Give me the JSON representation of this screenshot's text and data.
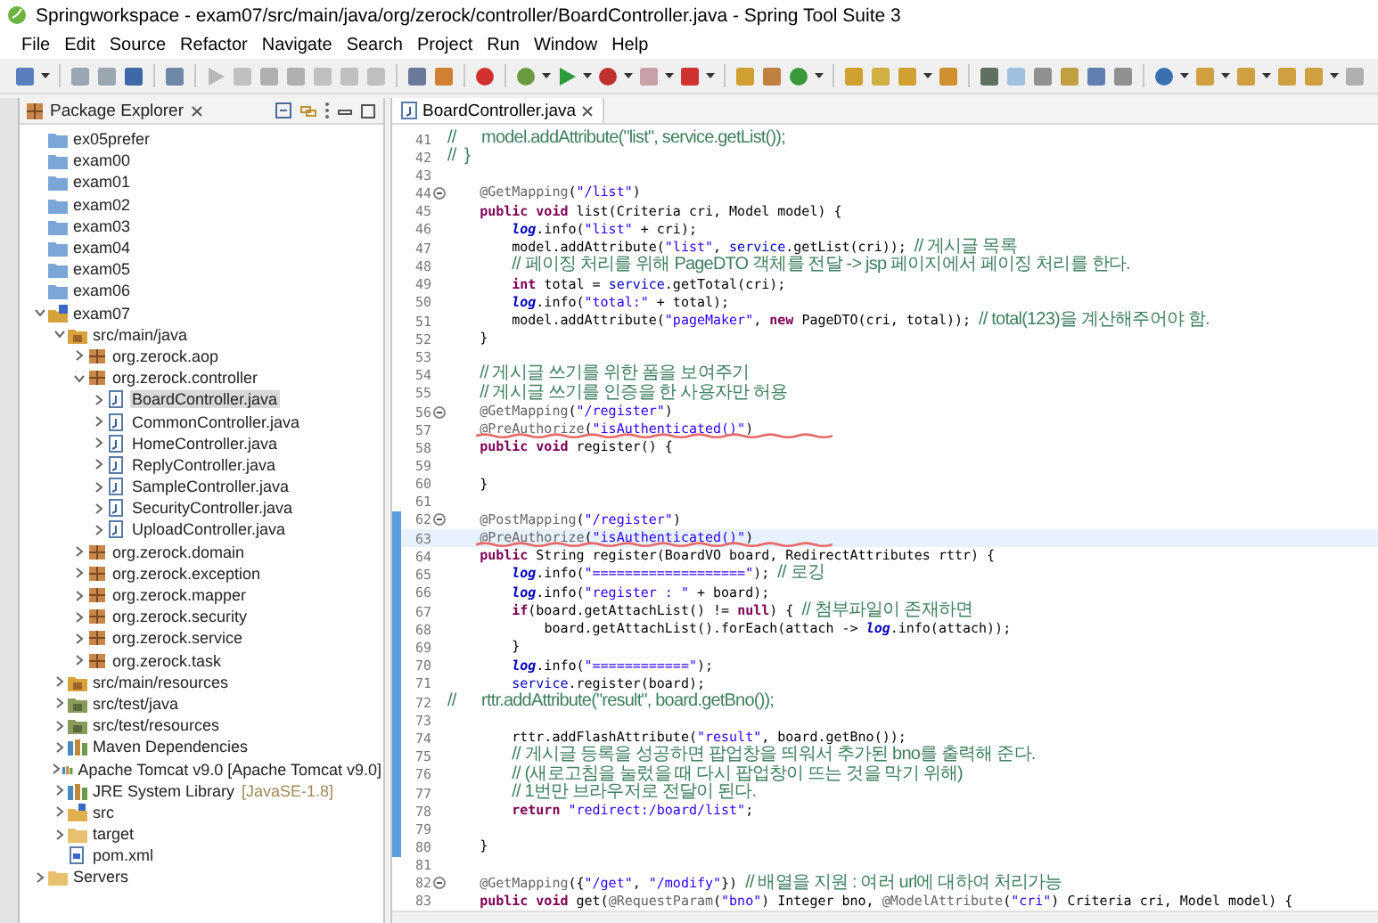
{
  "window": {
    "title": "Springworkspace - exam07/src/main/java/org/zerock/controller/BoardController.java - Spring Tool Suite 3"
  },
  "menu": [
    "File",
    "Edit",
    "Source",
    "Refactor",
    "Navigate",
    "Search",
    "Project",
    "Run",
    "Window",
    "Help"
  ],
  "package_explorer": {
    "title": "Package Explorer",
    "tree": [
      {
        "label": "ex05prefer",
        "kind": "closed_project",
        "selected": false
      },
      {
        "label": "exam00",
        "kind": "closed_project",
        "selected": false
      },
      {
        "label": "exam01",
        "kind": "closed_project",
        "selected": false
      },
      {
        "label": "exam02",
        "kind": "closed_project",
        "selected": false
      },
      {
        "label": "exam03",
        "kind": "closed_project",
        "selected": false
      },
      {
        "label": "exam04",
        "kind": "closed_project",
        "selected": false
      },
      {
        "label": "exam05",
        "kind": "closed_project",
        "selected": false
      },
      {
        "label": "exam06",
        "kind": "closed_project",
        "selected": false
      },
      {
        "label": "exam07",
        "kind": "project",
        "expanded": true,
        "selected": false,
        "children": [
          {
            "label": "src/main/java",
            "kind": "source_folder",
            "expanded": true,
            "selected": false,
            "children": [
              {
                "label": "org.zerock.aop",
                "kind": "package",
                "expanded": false,
                "selected": false
              },
              {
                "label": "org.zerock.controller",
                "kind": "package",
                "expanded": true,
                "selected": false,
                "children": [
                  {
                    "label": "BoardController.java",
                    "kind": "java_file",
                    "expanded": false,
                    "selected": true
                  },
                  {
                    "label": "CommonController.java",
                    "kind": "java_file",
                    "expanded": false,
                    "selected": false
                  },
                  {
                    "label": "HomeController.java",
                    "kind": "java_file",
                    "expanded": false,
                    "selected": false
                  },
                  {
                    "label": "ReplyController.java",
                    "kind": "java_file",
                    "expanded": false,
                    "selected": false
                  },
                  {
                    "label": "SampleController.java",
                    "kind": "java_file",
                    "expanded": false,
                    "selected": false
                  },
                  {
                    "label": "SecurityController.java",
                    "kind": "java_file",
                    "expanded": false,
                    "selected": false
                  },
                  {
                    "label": "UploadController.java",
                    "kind": "java_file",
                    "expanded": false,
                    "selected": false
                  }
                ]
              },
              {
                "label": "org.zerock.domain",
                "kind": "package",
                "expanded": false,
                "selected": false
              },
              {
                "label": "org.zerock.exception",
                "kind": "package",
                "expanded": false,
                "selected": false
              },
              {
                "label": "org.zerock.mapper",
                "kind": "package",
                "expanded": false,
                "selected": false
              },
              {
                "label": "org.zerock.security",
                "kind": "package",
                "expanded": false,
                "selected": false
              },
              {
                "label": "org.zerock.service",
                "kind": "package",
                "expanded": false,
                "selected": false
              },
              {
                "label": "org.zerock.task",
                "kind": "package",
                "expanded": false,
                "selected": false
              }
            ]
          },
          {
            "label": "src/main/resources",
            "kind": "source_folder",
            "expanded": false,
            "selected": false
          },
          {
            "label": "src/test/java",
            "kind": "test_folder",
            "expanded": false,
            "selected": false
          },
          {
            "label": "src/test/resources",
            "kind": "test_folder",
            "expanded": false,
            "selected": false
          },
          {
            "label": "Maven Dependencies",
            "kind": "library",
            "expanded": false,
            "selected": false
          },
          {
            "label": "Apache Tomcat v9.0 [Apache Tomcat v9.0]",
            "kind": "library",
            "expanded": false,
            "selected": false
          },
          {
            "label": "JRE System Library",
            "decoration": "[JavaSE-1.8]",
            "kind": "library",
            "expanded": false,
            "selected": false
          },
          {
            "label": "src",
            "kind": "spring_folder",
            "expanded": false,
            "selected": false
          },
          {
            "label": "target",
            "kind": "folder",
            "expanded": false,
            "selected": false
          },
          {
            "label": "pom.xml",
            "kind": "xml_file",
            "selected": false
          }
        ]
      },
      {
        "label": "Servers",
        "kind": "folder",
        "expanded": false,
        "selected": false
      }
    ]
  },
  "editor": {
    "tabs": [
      {
        "label": "BoardController.java",
        "selected": true
      }
    ],
    "lines": [
      {
        "number": "41",
        "fold": false,
        "changed": false,
        "current": false,
        "pen_mark": false,
        "tokens": [
          {
            "kind": "comment",
            "text": "//      model.addAttribute(\"list\", service.getList());"
          }
        ]
      },
      {
        "number": "42",
        "fold": false,
        "changed": false,
        "current": false,
        "pen_mark": false,
        "tokens": [
          {
            "kind": "comment",
            "text": "//  }"
          }
        ]
      },
      {
        "number": "43",
        "fold": false,
        "changed": false,
        "current": false,
        "pen_mark": false
      },
      {
        "number": "44",
        "fold": true,
        "changed": false,
        "current": false,
        "pen_mark": false,
        "tokens": [
          {
            "kind": "annotation",
            "text": "    @GetMapping"
          },
          {
            "kind": "plain",
            "text": "("
          },
          {
            "kind": "string",
            "text": "\"/list\""
          },
          {
            "kind": "plain",
            "text": ")"
          }
        ]
      },
      {
        "number": "45",
        "fold": false,
        "changed": false,
        "current": false,
        "pen_mark": false,
        "tokens": [
          {
            "kind": "keyword",
            "text": "    public void"
          },
          {
            "kind": "plain",
            "text": " list(Criteria cri, Model model) {"
          }
        ]
      },
      {
        "number": "46",
        "fold": false,
        "changed": false,
        "current": false,
        "pen_mark": false,
        "tokens": [
          {
            "kind": "static",
            "text": "        log"
          },
          {
            "kind": "plain",
            "text": ".info("
          },
          {
            "kind": "string",
            "text": "\"list\""
          },
          {
            "kind": "plain",
            "text": " + cri);"
          }
        ]
      },
      {
        "number": "47",
        "fold": false,
        "changed": false,
        "current": false,
        "pen_mark": false,
        "tokens": [
          {
            "kind": "plain",
            "text": "        model.addAttribute("
          },
          {
            "kind": "string",
            "text": "\"list\""
          },
          {
            "kind": "plain",
            "text": ", "
          },
          {
            "kind": "field",
            "text": "service"
          },
          {
            "kind": "plain",
            "text": ".getList(cri)); "
          },
          {
            "kind": "comment",
            "text": "// 게시글 목록"
          }
        ]
      },
      {
        "number": "48",
        "fold": false,
        "changed": false,
        "current": false,
        "pen_mark": false,
        "tokens": [
          {
            "kind": "comment",
            "text": "        // 페이징 처리를 위해 PageDTO 객체를 전달 -> jsp 페이지에서 페이징 처리를 한다."
          }
        ]
      },
      {
        "number": "49",
        "fold": false,
        "changed": false,
        "current": false,
        "pen_mark": false,
        "tokens": [
          {
            "kind": "keyword",
            "text": "        int"
          },
          {
            "kind": "plain",
            "text": " total = "
          },
          {
            "kind": "field",
            "text": "service"
          },
          {
            "kind": "plain",
            "text": ".getTotal(cri);"
          }
        ]
      },
      {
        "number": "50",
        "fold": false,
        "changed": false,
        "current": false,
        "pen_mark": false,
        "tokens": [
          {
            "kind": "static",
            "text": "        log"
          },
          {
            "kind": "plain",
            "text": ".info("
          },
          {
            "kind": "string",
            "text": "\"total:\""
          },
          {
            "kind": "plain",
            "text": " + total);"
          }
        ]
      },
      {
        "number": "51",
        "fold": false,
        "changed": false,
        "current": false,
        "pen_mark": false,
        "tokens": [
          {
            "kind": "plain",
            "text": "        model.addAttribute("
          },
          {
            "kind": "string",
            "text": "\"pageMaker\""
          },
          {
            "kind": "plain",
            "text": ", "
          },
          {
            "kind": "keyword",
            "text": "new"
          },
          {
            "kind": "plain",
            "text": " PageDTO(cri, total)); "
          },
          {
            "kind": "comment",
            "text": "// total(123)을 계산해주어야 함."
          }
        ]
      },
      {
        "number": "52",
        "fold": false,
        "changed": false,
        "current": false,
        "pen_mark": false,
        "tokens": [
          {
            "kind": "plain",
            "text": "    }"
          }
        ]
      },
      {
        "number": "53",
        "fold": false,
        "changed": false,
        "current": false,
        "pen_mark": false
      },
      {
        "number": "54",
        "fold": false,
        "changed": false,
        "current": false,
        "pen_mark": false,
        "tokens": [
          {
            "kind": "comment",
            "text": "    // 게시글 쓰기를 위한 폼을 보여주기"
          }
        ]
      },
      {
        "number": "55",
        "fold": false,
        "changed": false,
        "current": false,
        "pen_mark": false,
        "tokens": [
          {
            "kind": "comment",
            "text": "    // 게시글 쓰기를 인증을 한 사용자만 허용"
          }
        ]
      },
      {
        "number": "56",
        "fold": true,
        "changed": false,
        "current": false,
        "pen_mark": false,
        "tokens": [
          {
            "kind": "annotation",
            "text": "    @GetMapping"
          },
          {
            "kind": "plain",
            "text": "("
          },
          {
            "kind": "string",
            "text": "\"/register\""
          },
          {
            "kind": "plain",
            "text": ")"
          }
        ]
      },
      {
        "number": "57",
        "fold": false,
        "changed": false,
        "current": false,
        "pen_mark": true,
        "tokens": [
          {
            "kind": "annotation",
            "text": "    @PreAuthorize"
          },
          {
            "kind": "plain",
            "text": "("
          },
          {
            "kind": "string",
            "text": "\"isAuthenticated()\""
          },
          {
            "kind": "plain",
            "text": ")"
          }
        ]
      },
      {
        "number": "58",
        "fold": false,
        "changed": false,
        "current": false,
        "pen_mark": false,
        "tokens": [
          {
            "kind": "keyword",
            "text": "    public void"
          },
          {
            "kind": "plain",
            "text": " register() {"
          }
        ]
      },
      {
        "number": "59",
        "fold": false,
        "changed": false,
        "current": false,
        "pen_mark": false
      },
      {
        "number": "60",
        "fold": false,
        "changed": false,
        "current": false,
        "pen_mark": false,
        "tokens": [
          {
            "kind": "plain",
            "text": "    }"
          }
        ]
      },
      {
        "number": "61",
        "fold": false,
        "changed": false,
        "current": false,
        "pen_mark": false
      },
      {
        "number": "62",
        "fold": true,
        "changed": true,
        "current": false,
        "pen_mark": false,
        "tokens": [
          {
            "kind": "annotation",
            "text": "    @PostMapping"
          },
          {
            "kind": "plain",
            "text": "("
          },
          {
            "kind": "string",
            "text": "\"/register\""
          },
          {
            "kind": "plain",
            "text": ")"
          }
        ]
      },
      {
        "number": "63",
        "fold": false,
        "changed": true,
        "current": true,
        "pen_mark": true,
        "tokens": [
          {
            "kind": "annotation",
            "text": "    @PreAuthorize"
          },
          {
            "kind": "plain",
            "text": "("
          },
          {
            "kind": "string",
            "text": "\"isAuthenticated()\""
          },
          {
            "kind": "plain",
            "text": ")"
          }
        ]
      },
      {
        "number": "64",
        "fold": false,
        "changed": true,
        "current": false,
        "pen_mark": false,
        "tokens": [
          {
            "kind": "keyword",
            "text": "    public"
          },
          {
            "kind": "plain",
            "text": " String register(BoardVO board, RedirectAttributes rttr) {"
          }
        ]
      },
      {
        "number": "65",
        "fold": false,
        "changed": true,
        "current": false,
        "pen_mark": false,
        "tokens": [
          {
            "kind": "static",
            "text": "        log"
          },
          {
            "kind": "plain",
            "text": ".info("
          },
          {
            "kind": "string",
            "text": "\"===================\""
          },
          {
            "kind": "plain",
            "text": "); "
          },
          {
            "kind": "comment",
            "text": "// 로깅"
          }
        ]
      },
      {
        "number": "66",
        "fold": false,
        "changed": true,
        "current": false,
        "pen_mark": false,
        "tokens": [
          {
            "kind": "static",
            "text": "        log"
          },
          {
            "kind": "plain",
            "text": ".info("
          },
          {
            "kind": "string",
            "text": "\"register : \""
          },
          {
            "kind": "plain",
            "text": " + board);"
          }
        ]
      },
      {
        "number": "67",
        "fold": false,
        "changed": true,
        "current": false,
        "pen_mark": false,
        "tokens": [
          {
            "kind": "keyword",
            "text": "        if"
          },
          {
            "kind": "plain",
            "text": "(board.getAttachList() != "
          },
          {
            "kind": "keyword",
            "text": "null"
          },
          {
            "kind": "plain",
            "text": ") { "
          },
          {
            "kind": "comment",
            "text": "// 첨부파일이 존재하면"
          }
        ]
      },
      {
        "number": "68",
        "fold": false,
        "changed": true,
        "current": false,
        "pen_mark": false,
        "tokens": [
          {
            "kind": "plain",
            "text": "            board.getAttachList().forEach(attach -> "
          },
          {
            "kind": "static",
            "text": "log"
          },
          {
            "kind": "plain",
            "text": ".info(attach));"
          }
        ]
      },
      {
        "number": "69",
        "fold": false,
        "changed": true,
        "current": false,
        "pen_mark": false,
        "tokens": [
          {
            "kind": "plain",
            "text": "        }"
          }
        ]
      },
      {
        "number": "70",
        "fold": false,
        "changed": true,
        "current": false,
        "pen_mark": false,
        "tokens": [
          {
            "kind": "static",
            "text": "        log"
          },
          {
            "kind": "plain",
            "text": ".info("
          },
          {
            "kind": "string",
            "text": "\"============\""
          },
          {
            "kind": "plain",
            "text": ");"
          }
        ]
      },
      {
        "number": "71",
        "fold": false,
        "changed": true,
        "current": false,
        "pen_mark": false,
        "tokens": [
          {
            "kind": "field",
            "text": "        service"
          },
          {
            "kind": "plain",
            "text": ".register(board);"
          }
        ]
      },
      {
        "number": "72",
        "fold": false,
        "changed": true,
        "current": false,
        "pen_mark": false,
        "tokens": [
          {
            "kind": "comment",
            "text": "//      rttr.addAttribute(\"result\", board.getBno());"
          }
        ]
      },
      {
        "number": "73",
        "fold": false,
        "changed": true,
        "current": false,
        "pen_mark": false
      },
      {
        "number": "74",
        "fold": false,
        "changed": true,
        "current": false,
        "pen_mark": false,
        "tokens": [
          {
            "kind": "plain",
            "text": "        rttr.addFlashAttribute("
          },
          {
            "kind": "string",
            "text": "\"result\""
          },
          {
            "kind": "plain",
            "text": ", board.getBno());"
          }
        ]
      },
      {
        "number": "75",
        "fold": false,
        "changed": true,
        "current": false,
        "pen_mark": false,
        "tokens": [
          {
            "kind": "comment",
            "text": "        // 게시글 등록을 성공하면 팝업창을 띄워서 추가된 bno를 출력해 준다."
          }
        ]
      },
      {
        "number": "76",
        "fold": false,
        "changed": true,
        "current": false,
        "pen_mark": false,
        "tokens": [
          {
            "kind": "comment",
            "text": "        // (새로고침을 눌렀을 때 다시 팝업창이 뜨는 것을 막기 위해)"
          }
        ]
      },
      {
        "number": "77",
        "fold": false,
        "changed": true,
        "current": false,
        "pen_mark": false,
        "tokens": [
          {
            "kind": "comment",
            "text": "        // 1번만 브라우저로 전달이 된다."
          }
        ]
      },
      {
        "number": "78",
        "fold": false,
        "changed": true,
        "current": false,
        "pen_mark": false,
        "tokens": [
          {
            "kind": "keyword",
            "text": "        return "
          },
          {
            "kind": "string",
            "text": "\"redirect:/board/list\""
          },
          {
            "kind": "plain",
            "text": ";"
          }
        ]
      },
      {
        "number": "79",
        "fold": false,
        "changed": true,
        "current": false,
        "pen_mark": false
      },
      {
        "number": "80",
        "fold": false,
        "changed": true,
        "current": false,
        "pen_mark": false,
        "tokens": [
          {
            "kind": "plain",
            "text": "    }"
          }
        ]
      },
      {
        "number": "81",
        "fold": false,
        "changed": false,
        "current": false,
        "pen_mark": false
      },
      {
        "number": "82",
        "fold": true,
        "changed": false,
        "current": false,
        "pen_mark": false,
        "tokens": [
          {
            "kind": "annotation",
            "text": "    @GetMapping"
          },
          {
            "kind": "plain",
            "text": "({"
          },
          {
            "kind": "string",
            "text": "\"/get\""
          },
          {
            "kind": "plain",
            "text": ", "
          },
          {
            "kind": "string",
            "text": "\"/modify\""
          },
          {
            "kind": "plain",
            "text": "}) "
          },
          {
            "kind": "comment",
            "text": "// 배열을 지원 : 여러 url에 대하여 처리가능"
          }
        ]
      },
      {
        "number": "83",
        "fold": false,
        "changed": false,
        "current": false,
        "pen_mark": false,
        "tokens": [
          {
            "kind": "keyword",
            "text": "    public void"
          },
          {
            "kind": "plain",
            "text": " get("
          },
          {
            "kind": "annotation",
            "text": "@RequestParam"
          },
          {
            "kind": "plain",
            "text": "("
          },
          {
            "kind": "string",
            "text": "\"bno\""
          },
          {
            "kind": "plain",
            "text": ") Integer bno, "
          },
          {
            "kind": "annotation",
            "text": "@ModelAttribute"
          },
          {
            "kind": "plain",
            "text": "("
          },
          {
            "kind": "string",
            "text": "\"cri\""
          },
          {
            "kind": "plain",
            "text": ") Criteria cri, Model model) {"
          }
        ]
      }
    ]
  }
}
